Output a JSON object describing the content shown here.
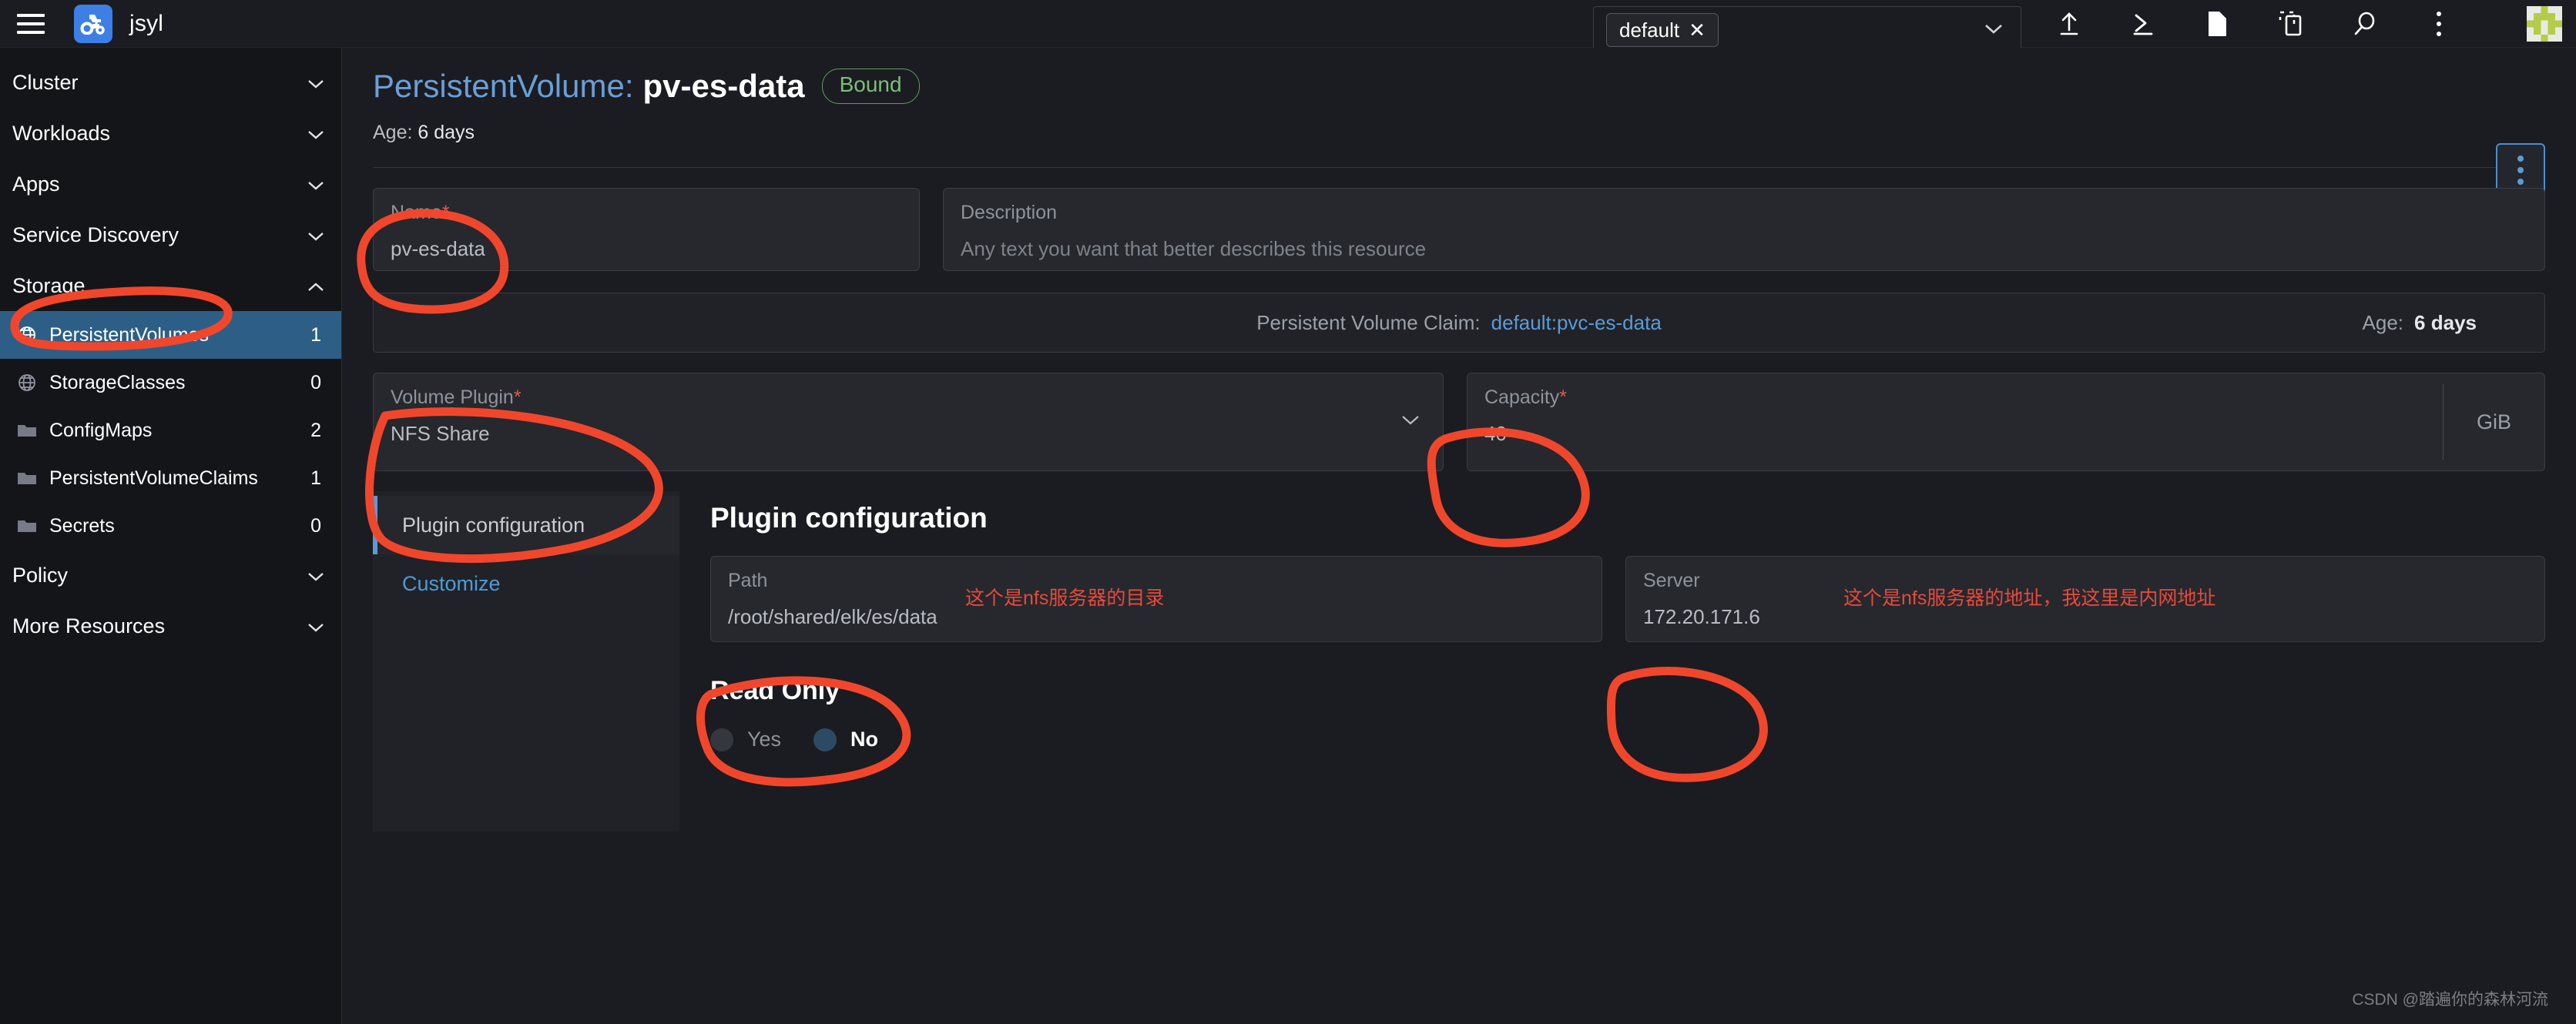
{
  "topbar": {
    "menu_icon": "hamburger-icon",
    "brand_name": "jsyl",
    "logo_icon": "rancher-tractor-logo",
    "namespace_selector": {
      "chip_label": "default",
      "chip_remove_icon": "close-icon",
      "caret_icon": "chevron-down-icon"
    },
    "icons": [
      {
        "name": "import-yaml-icon",
        "glyph": "upload"
      },
      {
        "name": "kubectl-shell-icon",
        "glyph": "prompt"
      },
      {
        "name": "download-kubeconfig-icon",
        "glyph": "file"
      },
      {
        "name": "copy-kubeconfig-icon",
        "glyph": "copy"
      },
      {
        "name": "search-icon",
        "glyph": "search"
      },
      {
        "name": "more-actions-icon",
        "glyph": "dots-vertical"
      }
    ],
    "avatar_icon": "user-avatar"
  },
  "sidebar": {
    "groups": [
      {
        "label": "Cluster",
        "expanded": false,
        "caret": "chevron-down-icon"
      },
      {
        "label": "Workloads",
        "expanded": false,
        "caret": "chevron-down-icon"
      },
      {
        "label": "Apps",
        "expanded": false,
        "caret": "chevron-down-icon"
      },
      {
        "label": "Service Discovery",
        "expanded": false,
        "caret": "chevron-down-icon"
      },
      {
        "label": "Storage",
        "expanded": true,
        "caret": "chevron-up-icon"
      }
    ],
    "storage_items": [
      {
        "label": "PersistentVolumes",
        "count": "1",
        "icon": "globe-icon",
        "active": true
      },
      {
        "label": "StorageClasses",
        "count": "0",
        "icon": "globe-icon",
        "active": false
      },
      {
        "label": "ConfigMaps",
        "count": "2",
        "icon": "folder-icon",
        "active": false
      },
      {
        "label": "PersistentVolumeClaims",
        "count": "1",
        "icon": "folder-icon",
        "active": false
      },
      {
        "label": "Secrets",
        "count": "0",
        "icon": "folder-icon",
        "active": false
      }
    ],
    "trailing_groups": [
      {
        "label": "Policy",
        "expanded": false,
        "caret": "chevron-down-icon"
      },
      {
        "label": "More Resources",
        "expanded": false,
        "caret": "chevron-down-icon"
      }
    ]
  },
  "page": {
    "kind": "PersistentVolume:",
    "name": "pv-es-data",
    "status_badge": "Bound",
    "age_label": "Age:",
    "age_value": "6 days",
    "actions_menu_icon": "dots-vertical-icon"
  },
  "form": {
    "name_field": {
      "label": "Name",
      "required_mark": "*",
      "value": "pv-es-data"
    },
    "description_field": {
      "label": "Description",
      "placeholder": "Any text you want that better describes this resource",
      "value": ""
    },
    "claim_bar": {
      "label": "Persistent Volume Claim:",
      "link": "default:pvc-es-data",
      "age_label": "Age:",
      "age_value": "6 days"
    },
    "volume_plugin": {
      "label": "Volume Plugin",
      "required_mark": "*",
      "value": "NFS Share",
      "caret_icon": "chevron-down-icon"
    },
    "capacity": {
      "label": "Capacity",
      "required_mark": "*",
      "value": "40",
      "unit": "GiB"
    }
  },
  "tabs": [
    {
      "label": "Plugin configuration",
      "active": true
    },
    {
      "label": "Customize",
      "active": false
    }
  ],
  "plugin_panel": {
    "heading": "Plugin configuration",
    "path_field": {
      "label": "Path",
      "value": "/root/shared/elk/es/data"
    },
    "path_note": "这个是nfs服务器的目录",
    "server_field": {
      "label": "Server",
      "value": "172.20.171.6"
    },
    "server_note": "这个是nfs服务器的地址，我这里是内网地址",
    "read_only": {
      "title": "Read Only",
      "options": [
        {
          "label": "Yes",
          "selected": false
        },
        {
          "label": "No",
          "selected": true
        }
      ]
    }
  },
  "watermark": "CSDN @踏遍你的森林河流",
  "colors": {
    "accent_blue": "#5b9bd5",
    "link_blue": "#4d9bd9",
    "status_green": "#7cbd7c",
    "annotation_red": "#e64a3c",
    "required_red": "#e05a4f",
    "sidebar_active": "#2d5f86",
    "logo_blue": "#3d7fe4"
  }
}
